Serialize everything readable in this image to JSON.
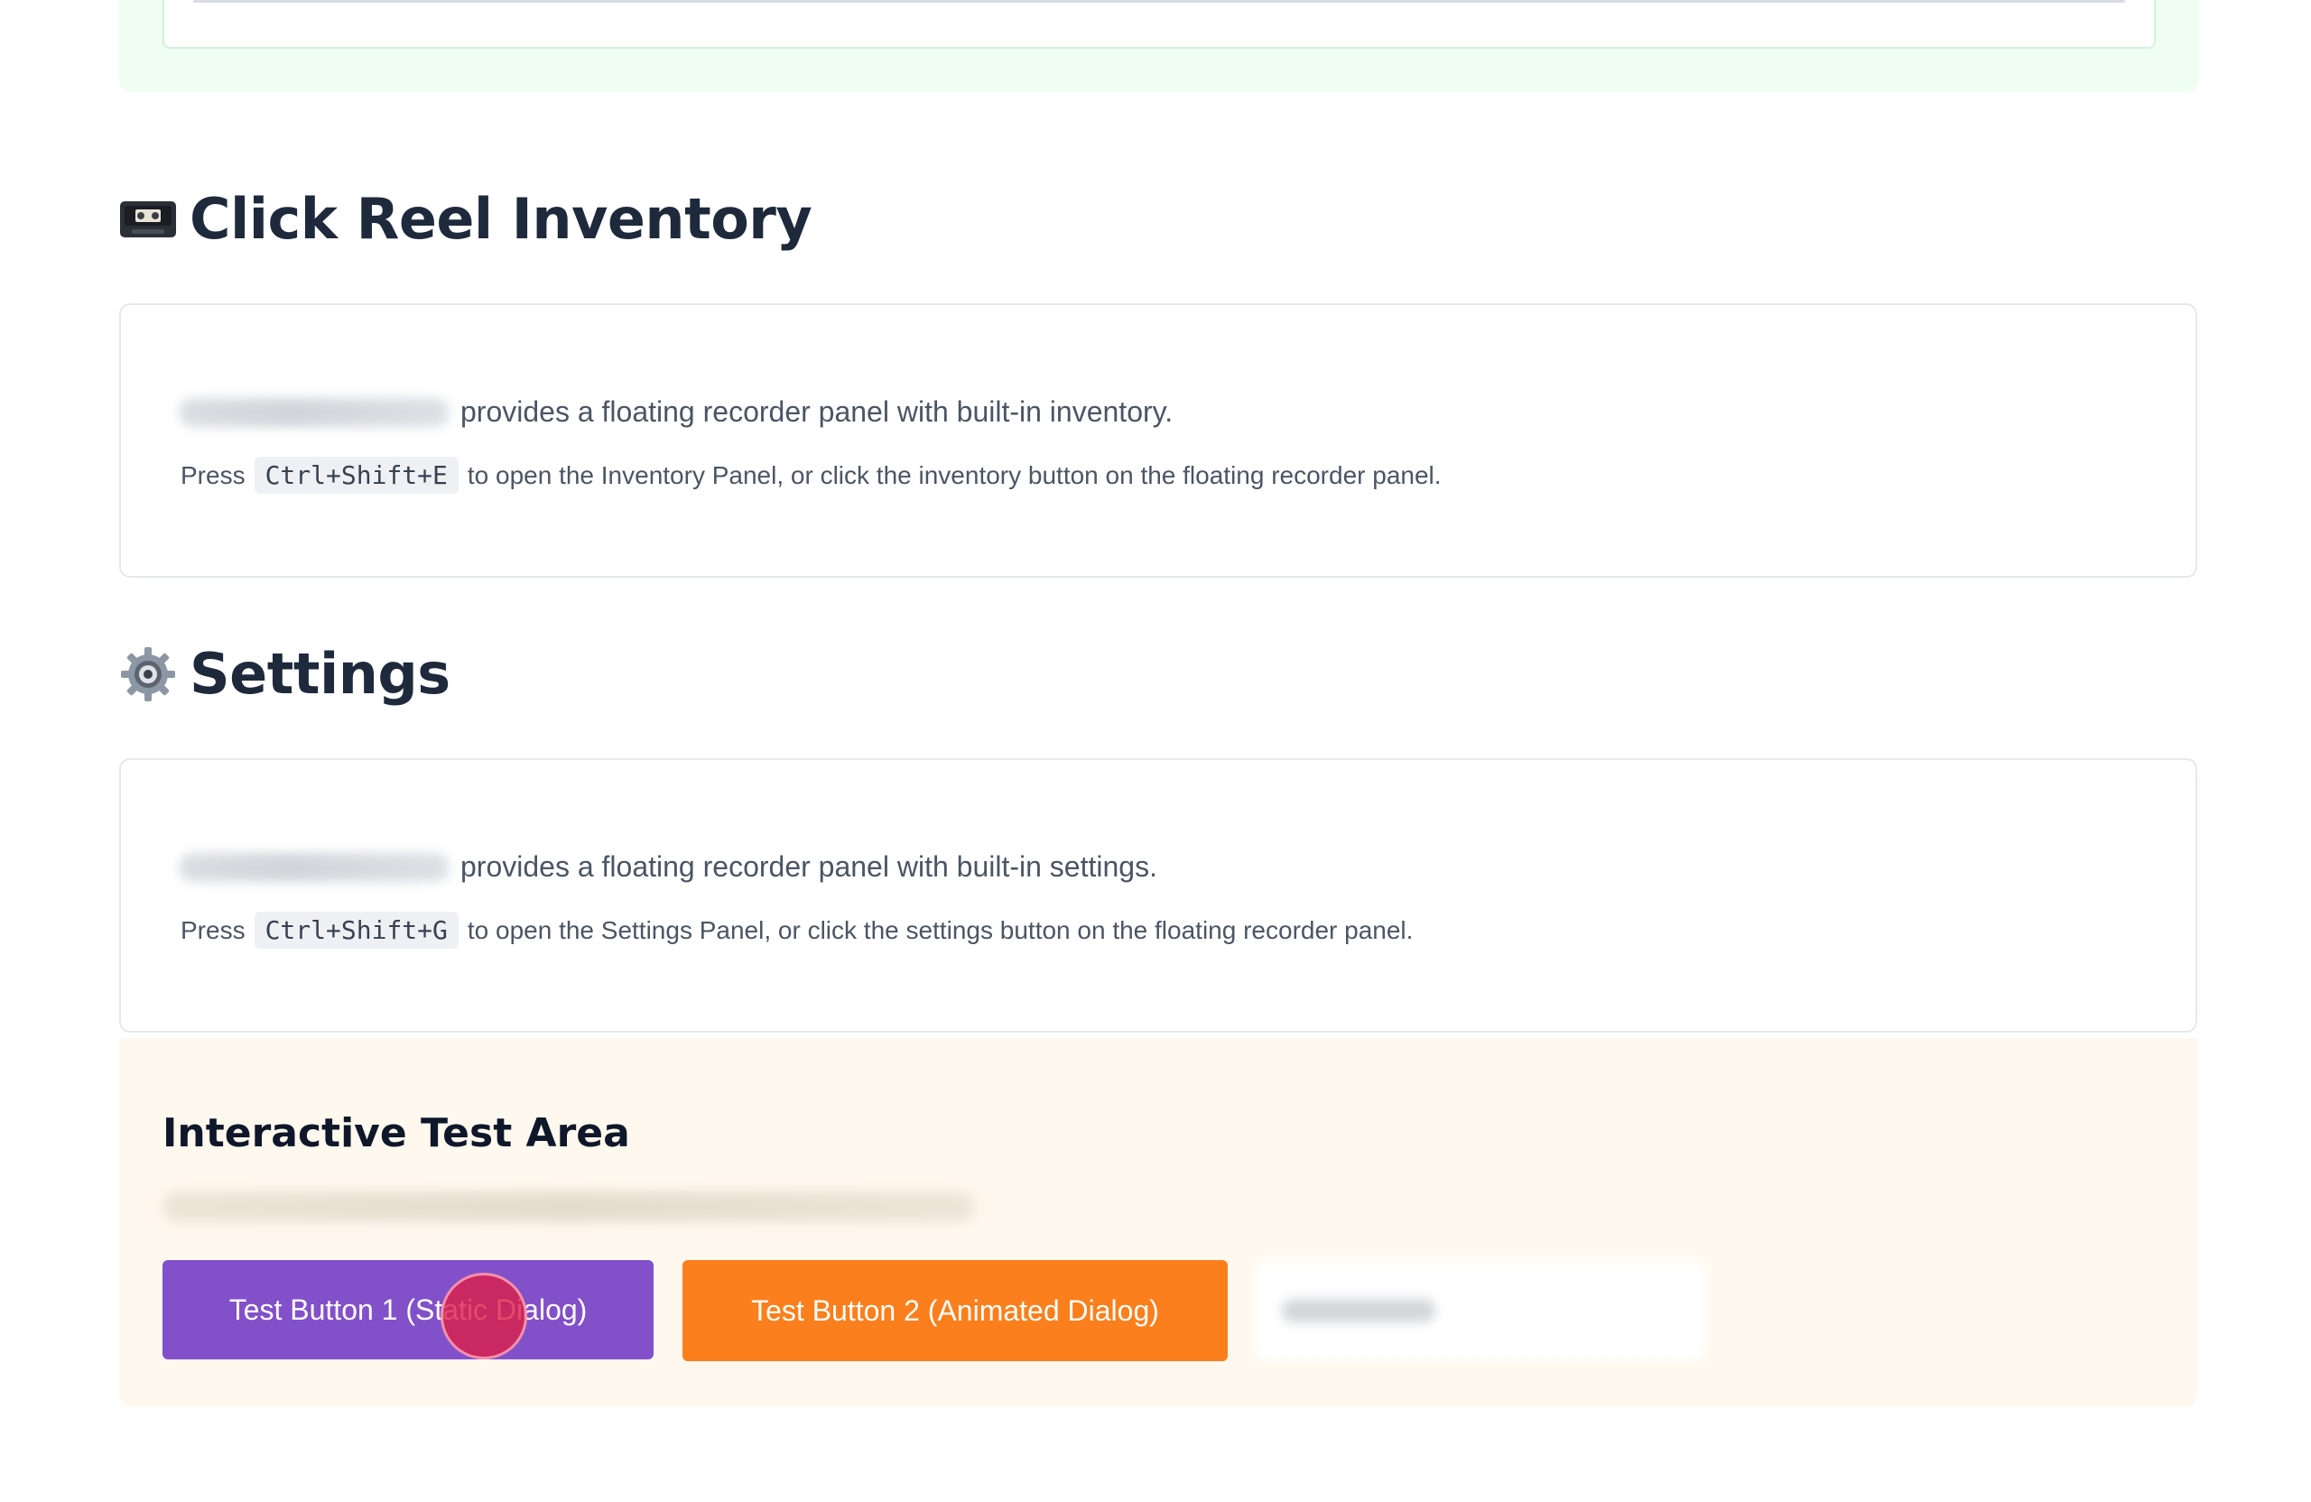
{
  "inventory": {
    "title": "Click Reel Inventory",
    "icon": "videocassette-icon",
    "lead_text": "provides a floating recorder panel with built-in inventory.",
    "hint_prefix": "Press",
    "shortcut": "Ctrl+Shift+E",
    "hint_suffix": "to open the Inventory Panel, or click the inventory button on the floating recorder panel."
  },
  "settings": {
    "title": "Settings",
    "icon": "gear-icon",
    "lead_text": "provides a floating recorder panel with built-in settings.",
    "hint_prefix": "Press",
    "shortcut": "Ctrl+Shift+G",
    "hint_suffix": "to open the Settings Panel, or click the settings button on the floating recorder panel."
  },
  "test_area": {
    "title": "Interactive Test Area",
    "button_1_label": "Test Button 1 (Static Dialog)",
    "button_2_label": "Test Button 2 (Animated Dialog)"
  },
  "colors": {
    "purple_button": "#8250c9",
    "orange_button": "#fb7f1c",
    "test_area_bg": "#fff8ee",
    "top_section_bg": "#effef0",
    "click_indicator": "#dc1e46"
  }
}
